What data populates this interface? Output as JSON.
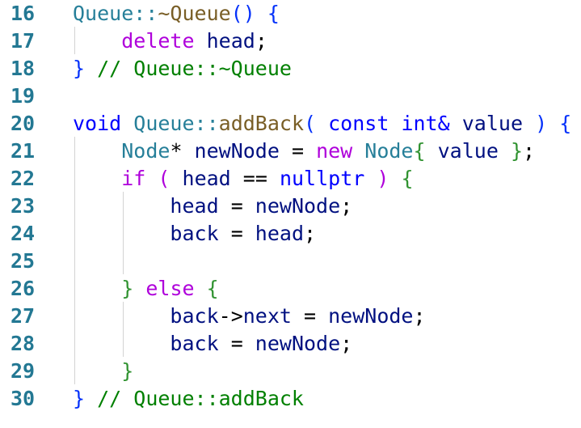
{
  "editor": {
    "lines": [
      {
        "number": "16",
        "tokens": [
          {
            "t": "Queue::",
            "c": "ns"
          },
          {
            "t": "~Queue",
            "c": "fn"
          },
          {
            "t": "()",
            "c": "br1"
          },
          {
            "t": " ",
            "c": "plain"
          },
          {
            "t": "{",
            "c": "br1"
          }
        ]
      },
      {
        "number": "17",
        "tokens": [
          {
            "t": "    ",
            "c": "plain"
          },
          {
            "t": "delete",
            "c": "ctrl"
          },
          {
            "t": " ",
            "c": "plain"
          },
          {
            "t": "head",
            "c": "var"
          },
          {
            "t": ";",
            "c": "plain"
          }
        ]
      },
      {
        "number": "18",
        "tokens": [
          {
            "t": "}",
            "c": "br1"
          },
          {
            "t": " // Queue::~Queue",
            "c": "com"
          }
        ]
      },
      {
        "number": "19",
        "tokens": []
      },
      {
        "number": "20",
        "tokens": [
          {
            "t": "void",
            "c": "kw"
          },
          {
            "t": " ",
            "c": "plain"
          },
          {
            "t": "Queue::",
            "c": "ns"
          },
          {
            "t": "addBack",
            "c": "fn"
          },
          {
            "t": "(",
            "c": "br1"
          },
          {
            "t": " ",
            "c": "plain"
          },
          {
            "t": "const",
            "c": "kw"
          },
          {
            "t": " ",
            "c": "plain"
          },
          {
            "t": "int&",
            "c": "kw"
          },
          {
            "t": " ",
            "c": "plain"
          },
          {
            "t": "value",
            "c": "var"
          },
          {
            "t": " ",
            "c": "plain"
          },
          {
            "t": ")",
            "c": "br1"
          },
          {
            "t": " ",
            "c": "plain"
          },
          {
            "t": "{",
            "c": "br1"
          }
        ]
      },
      {
        "number": "21",
        "tokens": [
          {
            "t": "    ",
            "c": "plain"
          },
          {
            "t": "Node",
            "c": "type"
          },
          {
            "t": "* ",
            "c": "plain"
          },
          {
            "t": "newNode",
            "c": "var"
          },
          {
            "t": " = ",
            "c": "plain"
          },
          {
            "t": "new",
            "c": "ctrl"
          },
          {
            "t": " ",
            "c": "plain"
          },
          {
            "t": "Node",
            "c": "type"
          },
          {
            "t": "{",
            "c": "br2"
          },
          {
            "t": " ",
            "c": "plain"
          },
          {
            "t": "value",
            "c": "var"
          },
          {
            "t": " ",
            "c": "plain"
          },
          {
            "t": "}",
            "c": "br2"
          },
          {
            "t": ";",
            "c": "plain"
          }
        ]
      },
      {
        "number": "22",
        "tokens": [
          {
            "t": "    ",
            "c": "plain"
          },
          {
            "t": "if",
            "c": "ctrl"
          },
          {
            "t": " ",
            "c": "plain"
          },
          {
            "t": "(",
            "c": "ctrl"
          },
          {
            "t": " ",
            "c": "plain"
          },
          {
            "t": "head",
            "c": "var"
          },
          {
            "t": " == ",
            "c": "plain"
          },
          {
            "t": "nullptr",
            "c": "kw"
          },
          {
            "t": " ",
            "c": "plain"
          },
          {
            "t": ")",
            "c": "ctrl"
          },
          {
            "t": " ",
            "c": "plain"
          },
          {
            "t": "{",
            "c": "br2"
          }
        ]
      },
      {
        "number": "23",
        "tokens": [
          {
            "t": "        ",
            "c": "plain"
          },
          {
            "t": "head",
            "c": "var"
          },
          {
            "t": " = ",
            "c": "plain"
          },
          {
            "t": "newNode",
            "c": "var"
          },
          {
            "t": ";",
            "c": "plain"
          }
        ]
      },
      {
        "number": "24",
        "tokens": [
          {
            "t": "        ",
            "c": "plain"
          },
          {
            "t": "back",
            "c": "var"
          },
          {
            "t": " = ",
            "c": "plain"
          },
          {
            "t": "head",
            "c": "var"
          },
          {
            "t": ";",
            "c": "plain"
          }
        ]
      },
      {
        "number": "25",
        "tokens": []
      },
      {
        "number": "26",
        "tokens": [
          {
            "t": "    ",
            "c": "plain"
          },
          {
            "t": "}",
            "c": "br2"
          },
          {
            "t": " ",
            "c": "plain"
          },
          {
            "t": "else",
            "c": "ctrl"
          },
          {
            "t": " ",
            "c": "plain"
          },
          {
            "t": "{",
            "c": "br2"
          }
        ]
      },
      {
        "number": "27",
        "tokens": [
          {
            "t": "        ",
            "c": "plain"
          },
          {
            "t": "back",
            "c": "var"
          },
          {
            "t": "->",
            "c": "plain"
          },
          {
            "t": "next",
            "c": "var"
          },
          {
            "t": " = ",
            "c": "plain"
          },
          {
            "t": "newNode",
            "c": "var"
          },
          {
            "t": ";",
            "c": "plain"
          }
        ]
      },
      {
        "number": "28",
        "tokens": [
          {
            "t": "        ",
            "c": "plain"
          },
          {
            "t": "back",
            "c": "var"
          },
          {
            "t": " = ",
            "c": "plain"
          },
          {
            "t": "newNode",
            "c": "var"
          },
          {
            "t": ";",
            "c": "plain"
          }
        ]
      },
      {
        "number": "29",
        "tokens": [
          {
            "t": "    ",
            "c": "plain"
          },
          {
            "t": "}",
            "c": "br2"
          }
        ]
      },
      {
        "number": "30",
        "tokens": [
          {
            "t": "}",
            "c": "br1"
          },
          {
            "t": " // Queue::addBack",
            "c": "com"
          }
        ]
      }
    ]
  },
  "colors": {
    "line_number": "#237893",
    "keyword": "#0000ff",
    "control": "#af00db",
    "type": "#267f99",
    "function": "#795e26",
    "variable": "#001080",
    "comment": "#008000",
    "indent_guide": "#d3d3d3"
  }
}
